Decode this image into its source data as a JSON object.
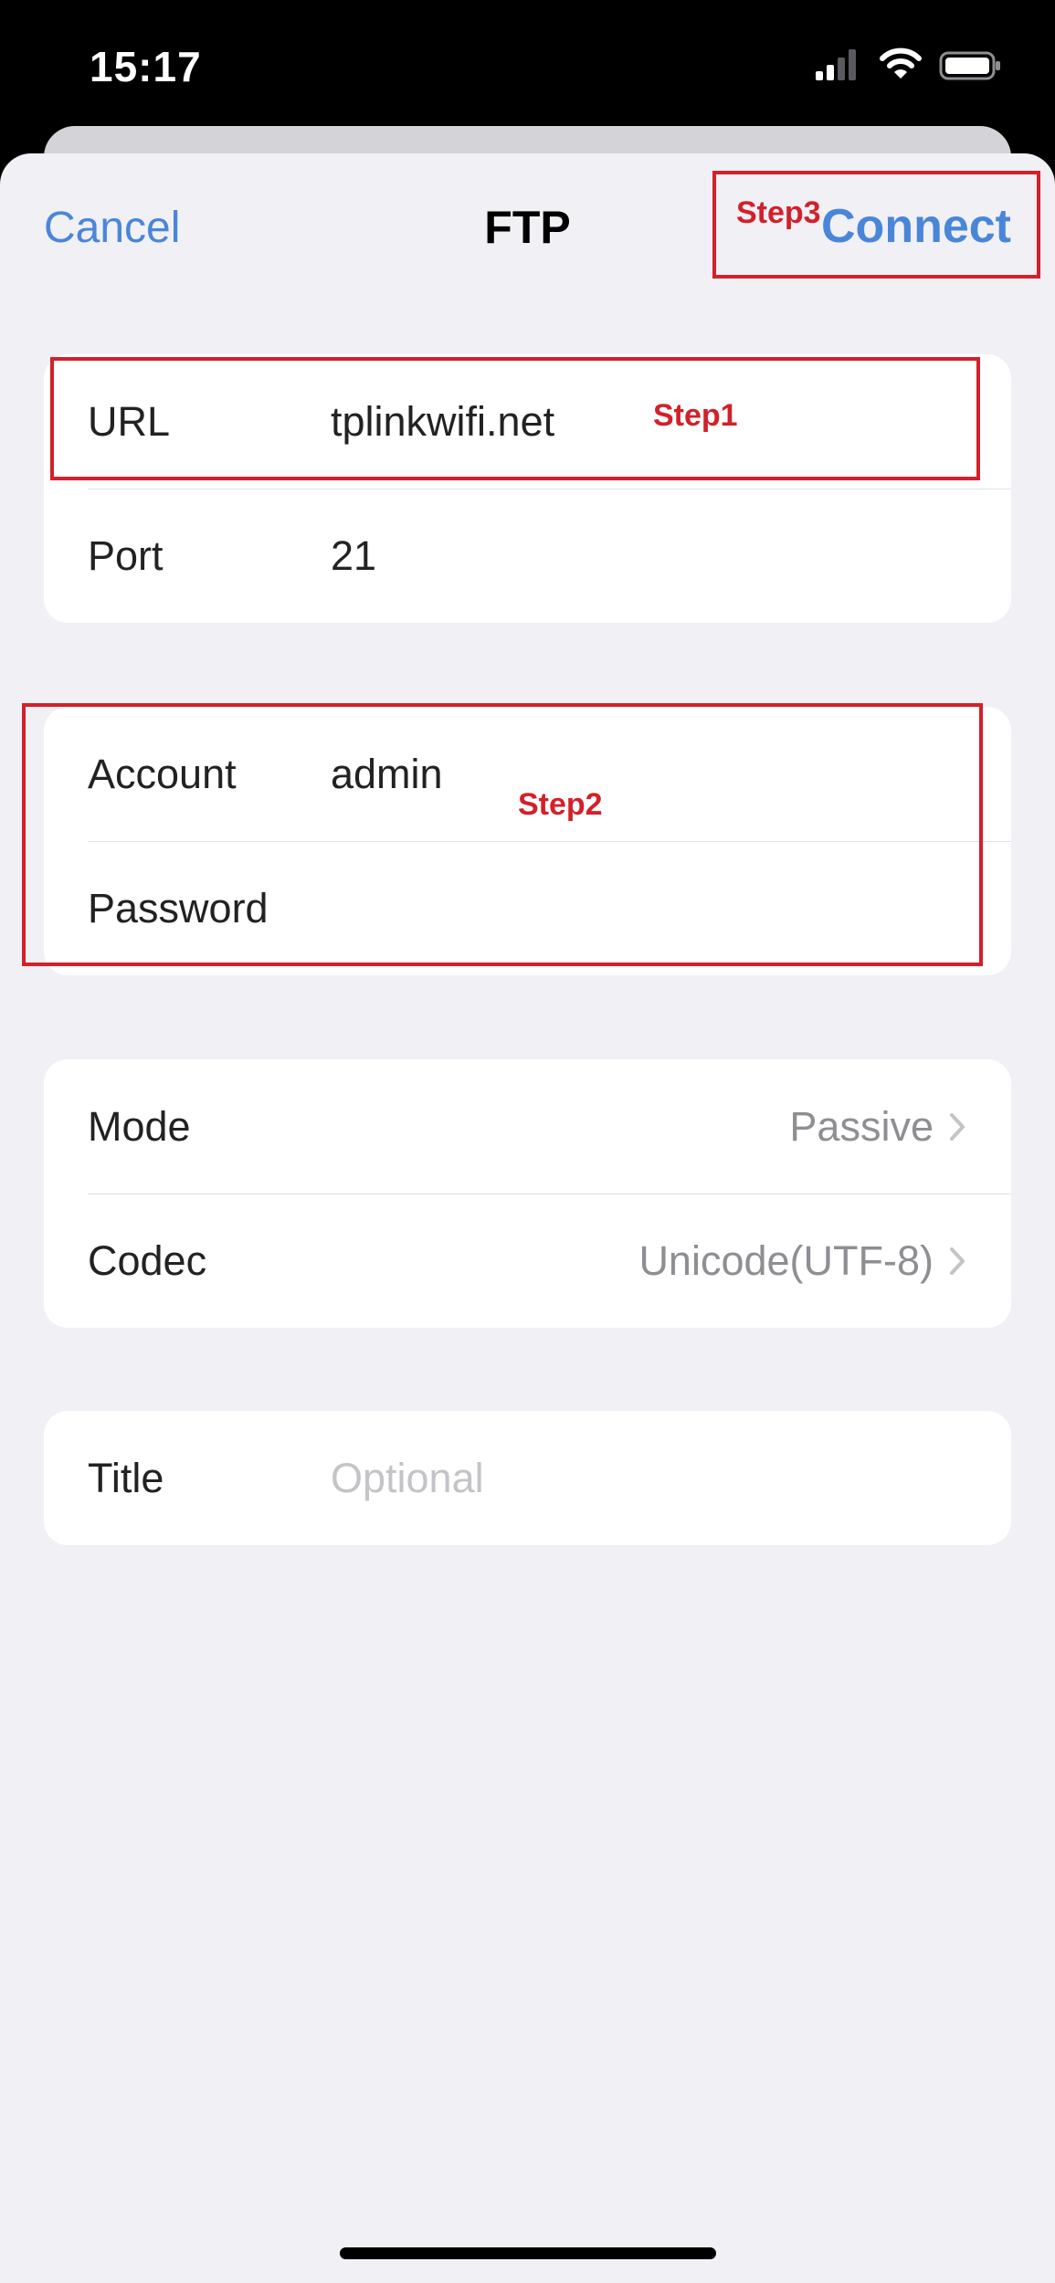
{
  "status_bar": {
    "time": "15:17",
    "icons": [
      "signal-icon",
      "wifi-icon",
      "battery-icon"
    ]
  },
  "nav": {
    "cancel_label": "Cancel",
    "title": "FTP",
    "connect_label": "Connect"
  },
  "server_group": {
    "url_label": "URL",
    "url_value": "tplinkwifi.net",
    "port_label": "Port",
    "port_value": "21"
  },
  "login_group": {
    "account_label": "Account",
    "account_value": "admin",
    "password_label": "Password",
    "password_value": ""
  },
  "options_group": {
    "mode_label": "Mode",
    "mode_value": "Passive",
    "codec_label": "Codec",
    "codec_value": "Unicode(UTF-8)"
  },
  "title_group": {
    "title_label": "Title",
    "title_placeholder": "Optional"
  },
  "annotations": {
    "step1": "Step1",
    "step2": "Step2",
    "step3": "Step3"
  },
  "colors": {
    "accent": "#4a86d8",
    "annotation": "#d3202a",
    "background": "#f0f0f5"
  }
}
